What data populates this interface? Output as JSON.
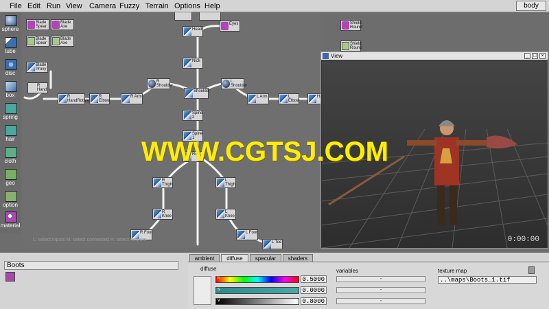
{
  "menu": [
    "File",
    "Edit",
    "Run",
    "View",
    "Camera",
    "Fuzzy",
    "Terrain",
    "Options",
    "Help"
  ],
  "body_field": "body",
  "palette": [
    {
      "label": "sphere",
      "color": "#3d6fb0"
    },
    {
      "label": "tube",
      "color": "#3d6fb0"
    },
    {
      "label": "disc",
      "color": "#3d6fb0"
    },
    {
      "label": "box",
      "color": "#3d6fb0"
    },
    {
      "label": "spring",
      "color": "#4aa8a0"
    },
    {
      "label": "hair",
      "color": "#4aa8a0"
    },
    {
      "label": "cloth",
      "color": "#5bb08a"
    },
    {
      "label": "geo",
      "color": "#7ab060"
    },
    {
      "label": "option",
      "color": "#8ab070"
    },
    {
      "label": "material",
      "color": "#a84ab0"
    }
  ],
  "graph": {
    "hint": "L: select inputs   M: select connected   R: select outputs",
    "nodes": {
      "blade_spear_1": "Blade\nSpear",
      "blade_axe_1": "Blade\nAxe",
      "blade_spear_2": "Blade\nSpear",
      "blade_axe_2": "Blade\nAxe",
      "blade_proxy": "Blade\nProxy",
      "r_hand": "R\nHand",
      "r_handrotate": "R\nHandRotate",
      "r_elbow": "R\nElbow",
      "r_arm": "R Arm",
      "r_shoulder": "R\nShoulder",
      "shoulder": "Shoulder",
      "l_shoulder": "L\nShoulder",
      "l_arm": "L Arm",
      "l_elbow": "L\nElbow",
      "l_ha": "Ha",
      "head": "Head",
      "eyes": "Eyes",
      "neck": "Nick",
      "spine2": "Spine\n2",
      "spine1": "Spine\n1",
      "root": "Root",
      "r_thigh": "R\nThigh",
      "l_thigh": "L\nThigh",
      "r_knee": "R\nKnee",
      "l_knee": "L\nKnee",
      "r_foot": "R Foot",
      "l_foot": "L Foot",
      "l_toe": "L Toe",
      "shield": "Shield\nRound",
      "shield2": "Shield\nRound"
    }
  },
  "view": {
    "title": "View",
    "time": "0:00:00",
    "btn_min": "_",
    "btn_max": "□",
    "btn_close": "×"
  },
  "watermark": "WWW.CGTSJ.COM",
  "bottom": {
    "object_name": "Boots",
    "tabs": [
      "ambient",
      "diffuse",
      "specular",
      "shaders"
    ],
    "active_tab": "diffuse",
    "section_label": "diffuse",
    "channels": [
      {
        "ch": "h",
        "value": "0.5000"
      },
      {
        "ch": "s",
        "value": "0.0000"
      },
      {
        "ch": "v",
        "value": "0.8000"
      }
    ],
    "variables_label": "variables",
    "var_placeholder": "-",
    "texture_label": "texture map",
    "texture_path": "..\\maps\\Boots_1.tif"
  }
}
